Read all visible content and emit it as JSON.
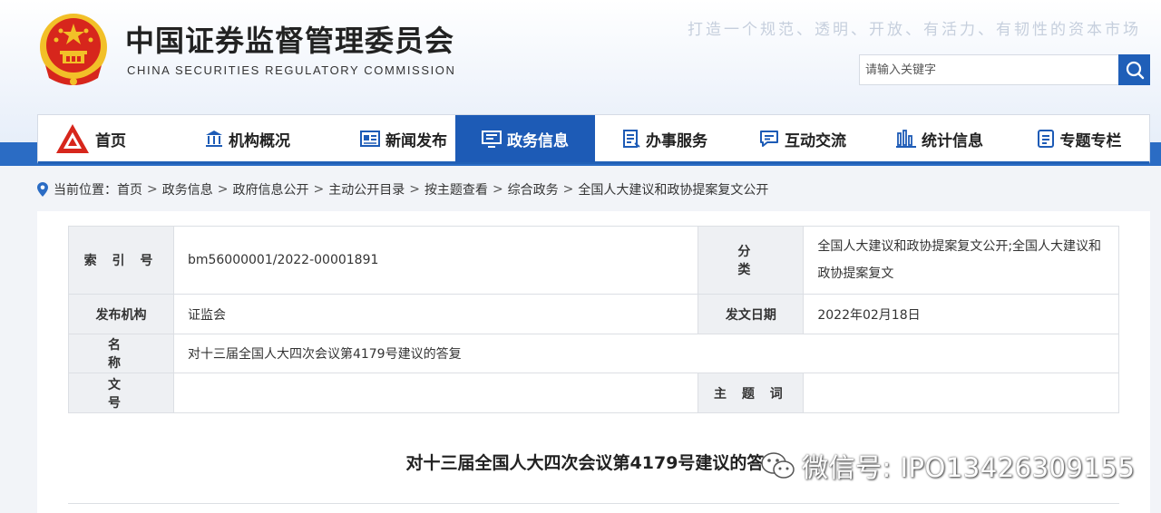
{
  "header": {
    "title": "中国证券监督管理委员会",
    "subtitle": "CHINA SECURITIES REGULATORY COMMISSION",
    "slogan": "打造一个规范、透明、开放、有活力、有韧性的资本市场",
    "emblem_icon": "national-emblem",
    "search": {
      "placeholder": "请输入关键字",
      "value": "",
      "icon": "search-icon"
    }
  },
  "nav": {
    "items": [
      {
        "label": "首页",
        "icon": "csrc-logo-icon",
        "active": false
      },
      {
        "label": "机构概况",
        "icon": "institution-icon",
        "active": false
      },
      {
        "label": "新闻发布",
        "icon": "news-icon",
        "active": false
      },
      {
        "label": "政务信息",
        "icon": "gov-info-icon",
        "active": true
      },
      {
        "label": "办事服务",
        "icon": "service-icon",
        "active": false
      },
      {
        "label": "互动交流",
        "icon": "chat-icon",
        "active": false
      },
      {
        "label": "统计信息",
        "icon": "stats-icon",
        "active": false
      },
      {
        "label": "专题专栏",
        "icon": "topic-icon",
        "active": false
      }
    ]
  },
  "breadcrumb": {
    "prefix": "当前位置：",
    "items": [
      "首页",
      "政务信息",
      "政府信息公开",
      "主动公开目录",
      "按主题查看",
      "综合政务",
      "全国人大建议和政协提案复文公开"
    ]
  },
  "meta_table": {
    "index_label": "索 引 号",
    "index_value": "bm56000001/2022-00001891",
    "category_label": "分 类",
    "category_value": "全国人大建议和政协提案复文公开;全国人大建议和政协提案复文",
    "publisher_label": "发布机构",
    "publisher_value": "证监会",
    "date_label": "发文日期",
    "date_value": "2022年02月18日",
    "name_label": "名 称",
    "name_value": "对十三届全国人大四次会议第4179号建议的答复",
    "docno_label": "文 号",
    "docno_value": "",
    "keywords_label": "主 题 词",
    "keywords_value": ""
  },
  "document": {
    "title": "对十三届全国人大四次会议第4179号建议的答复"
  },
  "watermark": {
    "text": "微信号: IPO13426309155",
    "icon": "wechat-icon"
  },
  "colors": {
    "primary": "#1d5bb6",
    "strip": "#2b6cc4",
    "label_bg": "#eef0f3",
    "emblem_red": "#d7261c",
    "emblem_gold": "#f2c028"
  }
}
